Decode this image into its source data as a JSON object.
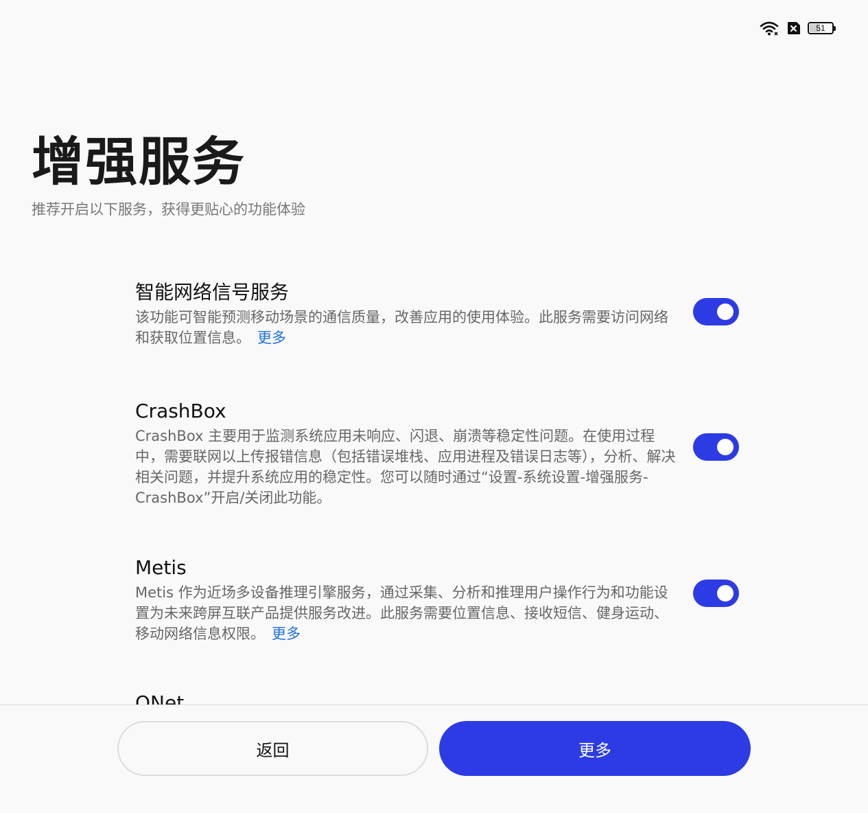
{
  "status_bar": {
    "wifi_icon": "wifi-icon",
    "sim_icon": "no-sim-icon",
    "battery_level": "51",
    "battery_percent": 51
  },
  "header": {
    "title": "增强服务",
    "subtitle": "推荐开启以下服务，获得更贴心的功能体验"
  },
  "services": [
    {
      "title": "智能网络信号服务",
      "description": "该功能可智能预测移动场景的通信质量，改善应用的使用体验。此服务需要访问网络和获取位置信息。",
      "more_label": "更多",
      "enabled": true
    },
    {
      "title": "CrashBox",
      "description": "CrashBox 主要用于监测系统应用未响应、闪退、崩溃等稳定性问题。在使用过程中，需要联网以上传报错信息（包括错误堆栈、应用进程及错误日志等），分析、解决相关问题，并提升系统应用的稳定性。您可以随时通过“设置-系统设置-增强服务-CrashBox”开启/关闭此功能。",
      "more_label": "",
      "enabled": true
    },
    {
      "title": "Metis",
      "description": "Metis 作为近场多设备推理引擎服务，通过采集、分析和推理用户操作行为和功能设置为未来跨屏互联产品提供服务改进。此服务需要位置信息、接收短信、健身运动、移动网络信息权限。",
      "more_label": "更多",
      "enabled": true
    },
    {
      "title": "ONet",
      "description": "",
      "more_label": "",
      "enabled": true
    }
  ],
  "footer": {
    "back_label": "返回",
    "more_label": "更多"
  },
  "colors": {
    "accent": "#2c3be3",
    "link": "#1e6fd9",
    "background": "#f9f9f9"
  }
}
